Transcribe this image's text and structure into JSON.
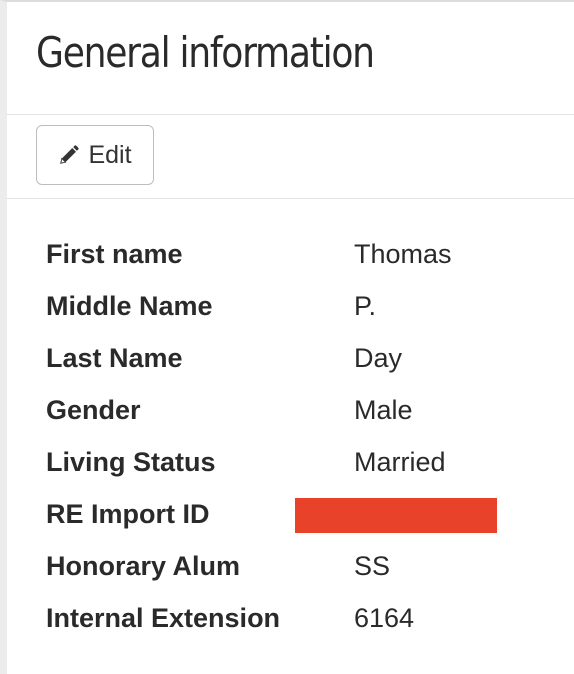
{
  "header": {
    "title": "General information"
  },
  "toolbar": {
    "edit_label": "Edit",
    "edit_icon": "pencil-icon"
  },
  "details": [
    {
      "label": "First name",
      "value": "Thomas"
    },
    {
      "label": "Middle Name",
      "value": "P."
    },
    {
      "label": "Last Name",
      "value": "Day"
    },
    {
      "label": "Gender",
      "value": "Male"
    },
    {
      "label": "Living Status",
      "value": "Married"
    },
    {
      "label": "RE Import ID",
      "value": null,
      "redacted": true
    },
    {
      "label": "Honorary Alum",
      "value": "SS"
    },
    {
      "label": "Internal Extension",
      "value": "6164"
    }
  ],
  "colors": {
    "redaction": "#e8422b",
    "text": "#2a2a2a",
    "border": "#bdbdbd"
  }
}
